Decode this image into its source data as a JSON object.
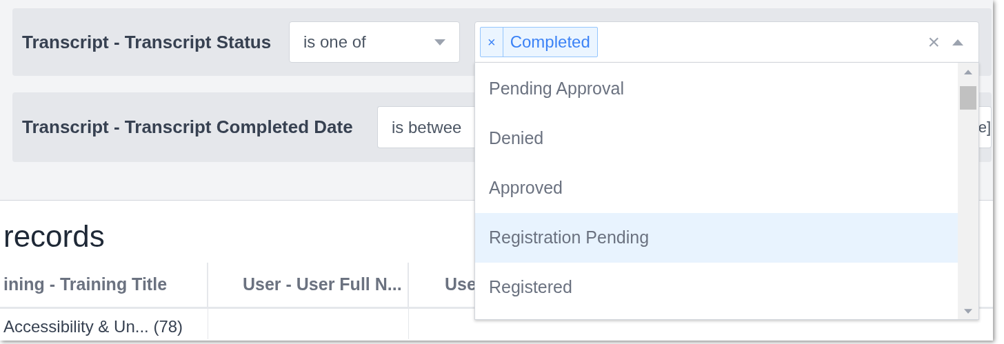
{
  "filters": [
    {
      "label": "Transcript - Transcript Status",
      "operator": "is one of",
      "values": [
        {
          "label": "Completed",
          "remove": "×"
        }
      ],
      "clear": "×",
      "expanded": true
    },
    {
      "label": "Transcript - Transcript Completed Date",
      "operator": "is betwee",
      "value_end": "e]"
    }
  ],
  "dropdown": {
    "options": [
      {
        "label": "Pending Approval",
        "highlighted": false
      },
      {
        "label": "Denied",
        "highlighted": false
      },
      {
        "label": "Approved",
        "highlighted": false
      },
      {
        "label": "Registration Pending",
        "highlighted": true
      },
      {
        "label": "Registered",
        "highlighted": false
      }
    ]
  },
  "results": {
    "heading": "records",
    "columns": [
      "ining - Training Title",
      "User - User Full N...",
      "Use"
    ],
    "rows": [
      [
        "Accessibility & Un... (78)"
      ]
    ]
  }
}
